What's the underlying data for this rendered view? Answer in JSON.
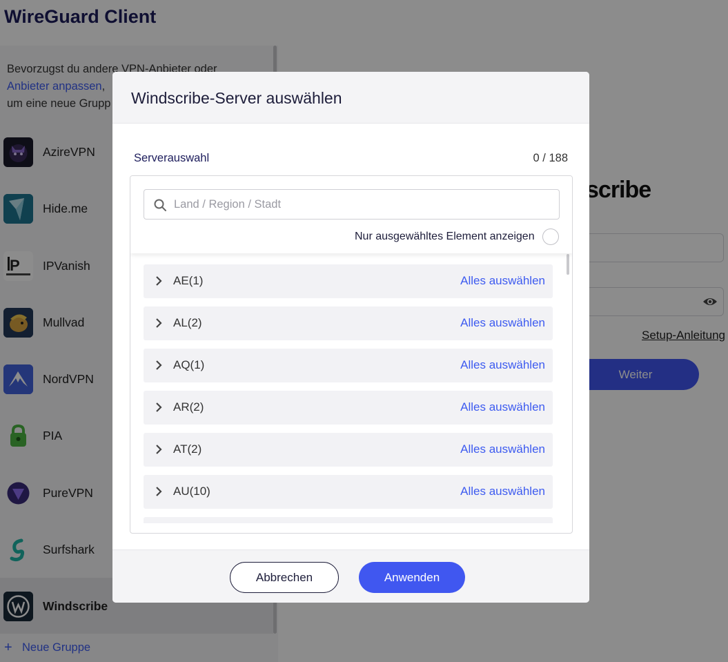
{
  "app": {
    "title": "WireGuard Client"
  },
  "sidebar": {
    "intro_part1": "Bevorzugst du andere VPN-Anbieter oder",
    "intro_link": "Anbieter anpassen",
    "intro_part2": ",",
    "intro_part3": "um eine neue Grupp",
    "providers": [
      {
        "name": "AzireVPN",
        "icon": "azirevpn-logo",
        "color": "#1a1a2a"
      },
      {
        "name": "Hide.me",
        "icon": "hideme-logo",
        "color": "#1e6f8c"
      },
      {
        "name": "IPVanish",
        "icon": "ipvanish-logo",
        "color": "#ffffff"
      },
      {
        "name": "Mullvad",
        "icon": "mullvad-logo",
        "color": "#1e3a5f"
      },
      {
        "name": "NordVPN",
        "icon": "nordvpn-logo",
        "color": "#3e5fd8"
      },
      {
        "name": "PIA",
        "icon": "pia-logo",
        "color": "#4bb543"
      },
      {
        "name": "PureVPN",
        "icon": "purevpn-logo",
        "color": "#6b4fd8"
      },
      {
        "name": "Surfshark",
        "icon": "surfshark-logo",
        "color": "#1fb5a7"
      },
      {
        "name": "Windscribe",
        "icon": "windscribe-logo",
        "color": "#1a2a3a",
        "active": true
      }
    ],
    "new_group": "Neue Gruppe"
  },
  "main": {
    "brand_partial": "scribe",
    "setup_link": "Setup-Anleitung",
    "continue_label": "Weiter"
  },
  "modal": {
    "title": "Windscribe-Server auswählen",
    "section_label": "Serverauswahl",
    "counter": "0 / 188",
    "search_placeholder": "Land / Region / Stadt",
    "only_selected_label": "Nur ausgewähltes Element anzeigen",
    "select_all_label": "Alles auswählen",
    "countries": [
      "AE(1)",
      "AL(2)",
      "AQ(1)",
      "AR(2)",
      "AT(2)",
      "AU(10)"
    ],
    "cancel_label": "Abbrechen",
    "apply_label": "Anwenden"
  },
  "colors": {
    "accent": "#4057f0",
    "link": "#3d5bf0",
    "title": "#1d1d5c"
  }
}
